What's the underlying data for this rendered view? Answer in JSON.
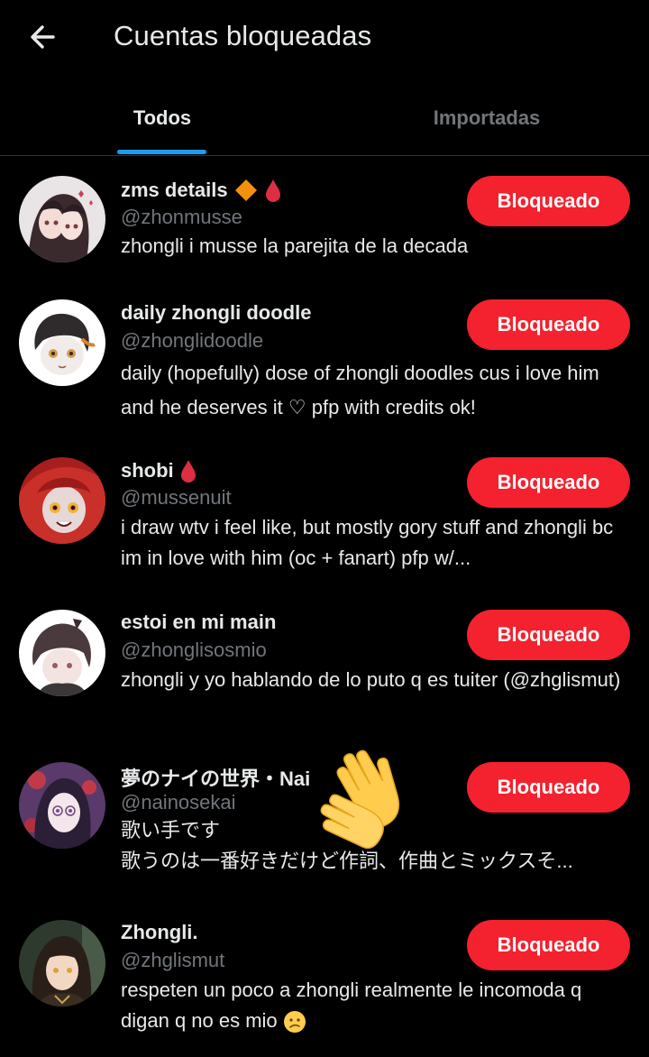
{
  "header": {
    "title": "Cuentas bloqueadas",
    "back_icon": "arrow-left-icon"
  },
  "tabs": [
    {
      "label": "Todos",
      "selected": true
    },
    {
      "label": "Importadas",
      "selected": false
    }
  ],
  "colors": {
    "background": "#000000",
    "accent": "#1d9bf0",
    "block_button": "#f4212e",
    "secondary_text": "#71767b"
  },
  "accounts": [
    {
      "name": "zms details",
      "name_emojis": [
        "orange-diamond-emoji",
        "drop-of-blood-emoji"
      ],
      "handle": "@zhonmusse",
      "bio": "zhongli i musse la parejita de la decada",
      "button": "Bloqueado"
    },
    {
      "name": "daily zhongli doodle",
      "name_emojis": [],
      "handle": "@zhonglidoodle",
      "bio": "daily (hopefully) dose of zhongli doodles cus i love him and he deserves it ♡ pfp with credits ok!",
      "button": "Bloqueado"
    },
    {
      "name": "shobi",
      "name_emojis": [
        "drop-of-blood-emoji"
      ],
      "handle": "@mussenuit",
      "bio": "i draw wtv i feel like, but mostly gory stuff and zhongli bc im in love with him (oc + fanart) pfp w/...",
      "button": "Bloqueado"
    },
    {
      "name": "estoi en mi main",
      "name_emojis": [],
      "handle": "@zhonglisosmio",
      "bio": "zhongli y yo hablando de lo puto q es tuiter (@zhglismut)",
      "button": "Bloqueado"
    },
    {
      "name": "夢のナイの世界・Nai",
      "name_emojis": [],
      "handle": "@nainosekai",
      "bio_line1": "歌い手です",
      "bio_line2": "歌うのは一番好きだけど作詞、作曲とミックスそ...",
      "button": "Bloqueado"
    },
    {
      "name": "Zhongli.",
      "name_emojis": [],
      "handle": "@zhglismut",
      "bio": "respeten un poco a zhongli realmente le incomoda q digan q no es mio",
      "bio_emoji": "confused-face-emoji",
      "button": "Bloqueado"
    }
  ],
  "overlay_sticker": "waving-hands-emoji"
}
